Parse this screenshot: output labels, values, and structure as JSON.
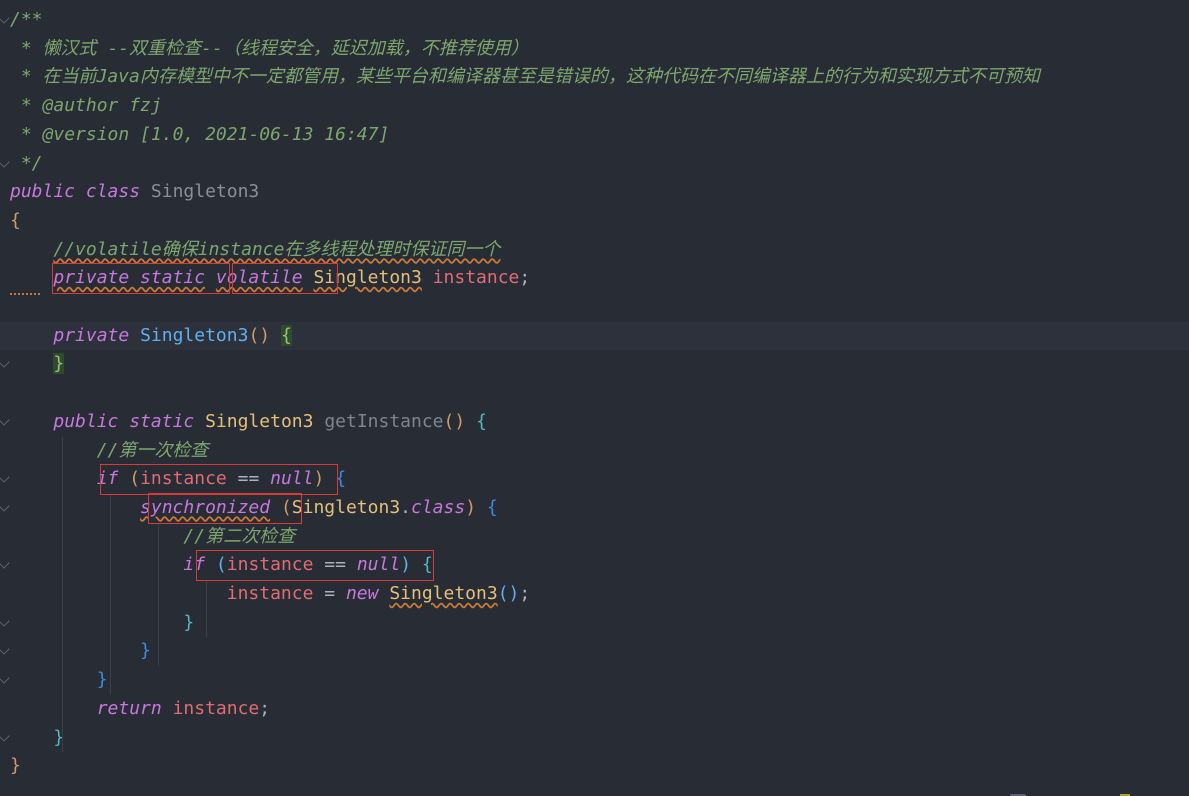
{
  "editor": {
    "lines": [
      [
        {
          "t": "/**",
          "c": "c-doc"
        }
      ],
      [
        {
          "t": " * 懒汉式 --双重检查--（线程安全，延迟加载，不推荐使用）",
          "c": "c-doc"
        }
      ],
      [
        {
          "t": " * 在当前Java内存模型中不一定都管用，某些平台和编译器甚至是错误的，这种代码在不同编译器上的行为和实现方式不可预知",
          "c": "c-doc"
        }
      ],
      [
        {
          "t": " * ",
          "c": "c-doc"
        },
        {
          "t": "@author",
          "c": "c-doctag"
        },
        {
          "t": " fzj",
          "c": "c-doc"
        }
      ],
      [
        {
          "t": " * ",
          "c": "c-doc"
        },
        {
          "t": "@version",
          "c": "c-doctag"
        },
        {
          "t": " [1.0, 2021-06-13 16:47]",
          "c": "c-doc"
        }
      ],
      [
        {
          "t": " */",
          "c": "c-doc"
        }
      ],
      [
        {
          "t": "public",
          "c": "c-kw"
        },
        {
          "t": " ",
          "c": "c-plain"
        },
        {
          "t": "class",
          "c": "c-kw"
        },
        {
          "t": " Singleton3",
          "c": "c-classname"
        }
      ],
      [
        {
          "t": "{",
          "c": "c-brace1"
        }
      ],
      [
        {
          "t": "    ",
          "c": "c-plain"
        },
        {
          "t": "//volatile确保instance在多线程处理时保证同一个",
          "c": "c-comment squig"
        }
      ],
      [
        {
          "t": "    ",
          "c": "c-plain"
        },
        {
          "t": "private static",
          "c": "c-kw squig"
        },
        {
          "t": " ",
          "c": "c-plain"
        },
        {
          "t": "volatile",
          "c": "c-kw squig"
        },
        {
          "t": " ",
          "c": "c-plain"
        },
        {
          "t": "Singleton3",
          "c": "c-type squig"
        },
        {
          "t": " ",
          "c": "c-plain"
        },
        {
          "t": "instance",
          "c": "c-field"
        },
        {
          "t": ";",
          "c": "c-plain"
        }
      ],
      [],
      [
        {
          "t": "    ",
          "c": "c-plain"
        },
        {
          "t": "private",
          "c": "c-kw"
        },
        {
          "t": " ",
          "c": "c-plain"
        },
        {
          "t": "Singleton3",
          "c": "c-fn"
        },
        {
          "t": "()",
          "c": "c-paren"
        },
        {
          "t": " ",
          "c": "c-plain"
        },
        {
          "t": "{",
          "c": "c-bracehl"
        }
      ],
      [
        {
          "t": "    ",
          "c": "c-plain"
        },
        {
          "t": "}",
          "c": "c-bracehl"
        }
      ],
      [],
      [
        {
          "t": "    ",
          "c": "c-plain"
        },
        {
          "t": "public static",
          "c": "c-kw"
        },
        {
          "t": " ",
          "c": "c-plain"
        },
        {
          "t": "Singleton3",
          "c": "c-type"
        },
        {
          "t": " ",
          "c": "c-plain"
        },
        {
          "t": "getInstance",
          "c": "c-greyfn"
        },
        {
          "t": "()",
          "c": "c-paren"
        },
        {
          "t": " ",
          "c": "c-plain"
        },
        {
          "t": "{",
          "c": "c-brace2"
        }
      ],
      [
        {
          "t": "        ",
          "c": "c-plain"
        },
        {
          "t": "//第一次检查",
          "c": "c-comment"
        }
      ],
      [
        {
          "t": "        ",
          "c": "c-plain"
        },
        {
          "t": "if",
          "c": "c-kw"
        },
        {
          "t": " ",
          "c": "c-plain"
        },
        {
          "t": "(",
          "c": "c-paren"
        },
        {
          "t": "instance",
          "c": "c-field"
        },
        {
          "t": " == ",
          "c": "c-plain"
        },
        {
          "t": "null",
          "c": "c-kw"
        },
        {
          "t": ")",
          "c": "c-paren"
        },
        {
          "t": " ",
          "c": "c-plain"
        },
        {
          "t": "{",
          "c": "c-brace3"
        }
      ],
      [
        {
          "t": "            ",
          "c": "c-plain"
        },
        {
          "t": "synchronized",
          "c": "c-kw squig"
        },
        {
          "t": " ",
          "c": "c-plain"
        },
        {
          "t": "(",
          "c": "c-paren"
        },
        {
          "t": "Singleton3",
          "c": "c-type"
        },
        {
          "t": ".",
          "c": "c-plain"
        },
        {
          "t": "class",
          "c": "c-kw"
        },
        {
          "t": ")",
          "c": "c-paren"
        },
        {
          "t": " ",
          "c": "c-plain"
        },
        {
          "t": "{",
          "c": "c-brace3"
        }
      ],
      [
        {
          "t": "                ",
          "c": "c-plain"
        },
        {
          "t": "//第二次检查",
          "c": "c-comment"
        }
      ],
      [
        {
          "t": "                ",
          "c": "c-plain"
        },
        {
          "t": "if",
          "c": "c-kw"
        },
        {
          "t": " ",
          "c": "c-plain"
        },
        {
          "t": "(",
          "c": "c-fn"
        },
        {
          "t": "instance",
          "c": "c-field"
        },
        {
          "t": " == ",
          "c": "c-plain"
        },
        {
          "t": "null",
          "c": "c-kw"
        },
        {
          "t": ")",
          "c": "c-fn"
        },
        {
          "t": " ",
          "c": "c-plain"
        },
        {
          "t": "{",
          "c": "c-brace2"
        }
      ],
      [
        {
          "t": "                    ",
          "c": "c-plain"
        },
        {
          "t": "instance",
          "c": "c-field"
        },
        {
          "t": " = ",
          "c": "c-plain"
        },
        {
          "t": "new",
          "c": "c-kw"
        },
        {
          "t": " ",
          "c": "c-plain"
        },
        {
          "t": "Singleton3",
          "c": "c-type squig"
        },
        {
          "t": "()",
          "c": "c-fn"
        },
        {
          "t": ";",
          "c": "c-plain"
        }
      ],
      [
        {
          "t": "                ",
          "c": "c-plain"
        },
        {
          "t": "}",
          "c": "c-brace2"
        }
      ],
      [
        {
          "t": "            ",
          "c": "c-plain"
        },
        {
          "t": "}",
          "c": "c-brace3"
        }
      ],
      [
        {
          "t": "        ",
          "c": "c-plain"
        },
        {
          "t": "}",
          "c": "c-brace3"
        }
      ],
      [
        {
          "t": "        ",
          "c": "c-plain"
        },
        {
          "t": "return",
          "c": "c-kw"
        },
        {
          "t": " ",
          "c": "c-plain"
        },
        {
          "t": "instance",
          "c": "c-field"
        },
        {
          "t": ";",
          "c": "c-plain"
        }
      ],
      [
        {
          "t": "    ",
          "c": "c-plain"
        },
        {
          "t": "}",
          "c": "c-brace2"
        }
      ],
      [
        {
          "t": "}",
          "c": "c-brace1"
        }
      ]
    ],
    "current_line_index": 11,
    "fold_marker_lines": [
      0,
      5,
      11,
      12,
      14,
      16,
      17,
      19,
      21,
      22,
      23,
      25
    ],
    "highlight_boxes": [
      {
        "name": "private-static-highlight",
        "line": 9,
        "colStart": 4,
        "colEnd": 18
      },
      {
        "name": "volatile-highlight",
        "line": 9,
        "colStart": 19,
        "colEnd": 27
      },
      {
        "name": "first-if-highlight",
        "line": 16,
        "colStart": 8,
        "colEnd": 27
      },
      {
        "name": "synchronized-highlight",
        "line": 17,
        "colStart": 12,
        "colEnd": 24
      },
      {
        "name": "second-if-highlight",
        "line": 19,
        "colStart": 16,
        "colEnd": 35
      }
    ]
  }
}
